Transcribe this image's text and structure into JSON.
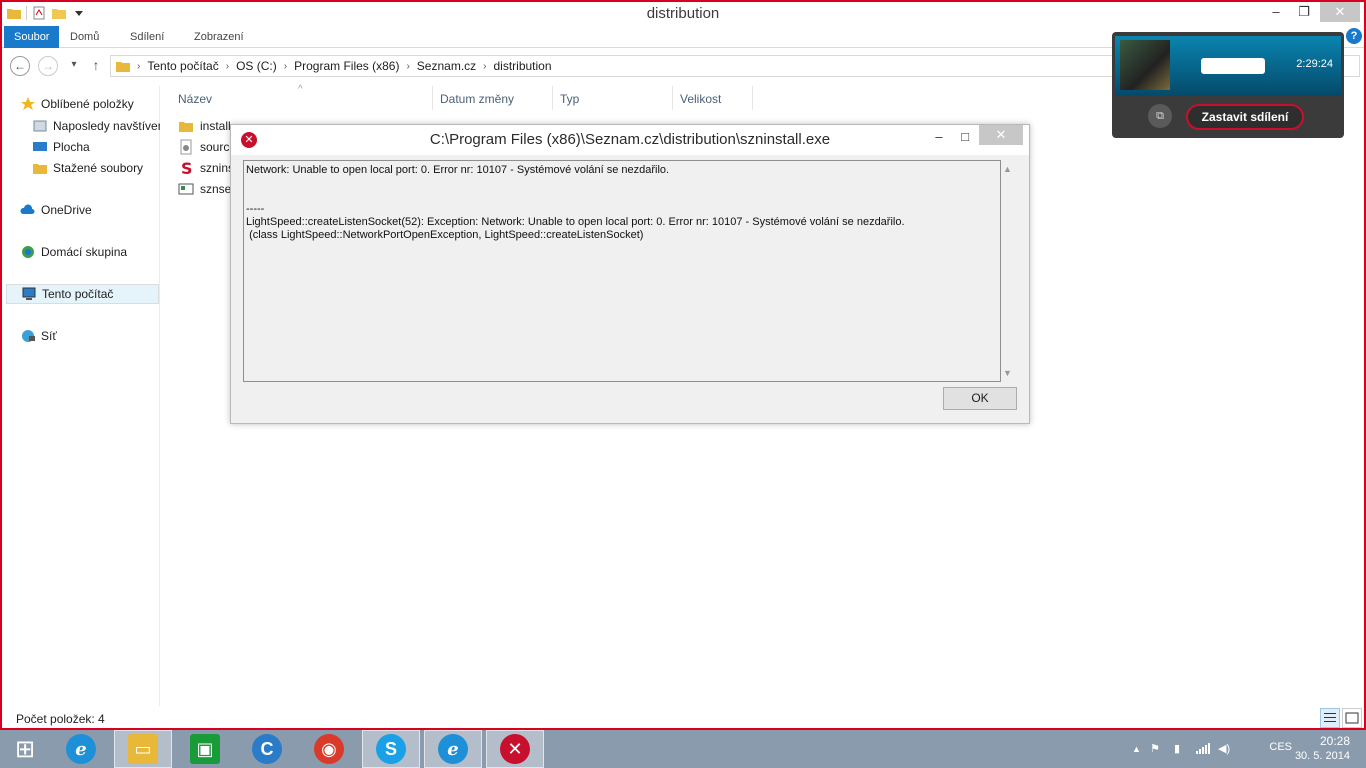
{
  "window": {
    "title": "distribution",
    "minimize_glyph": "‒",
    "restore_glyph": "❐",
    "close_glyph": "✕"
  },
  "ribbon": {
    "tabs": [
      "Soubor",
      "Domů",
      "Sdílení",
      "Zobrazení"
    ],
    "help_glyph": "?"
  },
  "address": {
    "crumbs": [
      "Tento počítač",
      "OS (C:)",
      "Program Files (x86)",
      "Seznam.cz",
      "distribution"
    ],
    "back_glyph": "←",
    "forward_glyph": "→",
    "recent_glyph": "▾",
    "up_glyph": "↑",
    "sep_glyph": "›"
  },
  "navpane": {
    "favorites": "Oblíbené položky",
    "recent": "Naposledy navštívené",
    "desktop": "Plocha",
    "downloads": "Stažené soubory",
    "onedrive": "OneDrive",
    "homegroup": "Domácí skupina",
    "thispc": "Tento počítač",
    "network": "Síť"
  },
  "columns": {
    "name": "Název",
    "date": "Datum změny",
    "type": "Typ",
    "size": "Velikost",
    "sort_glyph": "^"
  },
  "files": [
    {
      "name": "install",
      "icon": "folder-icon"
    },
    {
      "name": "source",
      "icon": "gear-file-icon"
    },
    {
      "name": "szninst",
      "icon": "seznam-icon"
    },
    {
      "name": "sznset",
      "icon": "settings-file-icon"
    }
  ],
  "status": {
    "count": "Počet položek: 4"
  },
  "dialog": {
    "title": "C:\\Program Files (x86)\\Seznam.cz\\distribution\\szninstall.exe",
    "message": "Network: Unable to open local port: 0. Error nr: 10107 - Systémové volání se nezdařilo.\n\n\n-----\nLightSpeed::createListenSocket(52): Exception: Network: Unable to open local port: 0. Error nr: 10107 - Systémové volání se nezdařilo.\n (class LightSpeed::NetworkPortOpenException, LightSpeed::createListenSocket)",
    "ok": "OK",
    "error_glyph": "✕",
    "minimize_glyph": "‒",
    "maximize_glyph": "□",
    "close_glyph": "✕",
    "scroll_up": "▲",
    "scroll_down": "▼"
  },
  "share": {
    "time": "2:29:24",
    "stop_label": "Zastavit sdílení",
    "popout_glyph": "⧉"
  },
  "taskbar": {
    "start_glyph": "⊞",
    "apps": [
      {
        "name": "ie",
        "glyph": "e",
        "color": "#1e90d8"
      },
      {
        "name": "explorer",
        "glyph": "▭",
        "color": "#e8b83a"
      },
      {
        "name": "store",
        "glyph": "▣",
        "color": "#1a9b3a"
      },
      {
        "name": "app-c",
        "glyph": "C",
        "color": "#2a7bc8"
      },
      {
        "name": "chrome",
        "glyph": "◉",
        "color": "#d93a2a"
      },
      {
        "name": "skype",
        "glyph": "S",
        "color": "#1aa0e6"
      },
      {
        "name": "ie2",
        "glyph": "e",
        "color": "#1e90d8"
      },
      {
        "name": "error",
        "glyph": "✕",
        "color": "#c8102e"
      }
    ],
    "tray": {
      "language": "CES",
      "time": "20:28",
      "date": "30. 5. 2014",
      "show_hidden_glyph": "▲",
      "flag_glyph": "⚑",
      "signal_glyph": "▮",
      "volume_glyph": "◀)"
    }
  },
  "colors": {
    "accent": "#1979ca",
    "window_border": "#d8001e",
    "taskbar": "#8a9bae",
    "error": "#c8102e"
  }
}
